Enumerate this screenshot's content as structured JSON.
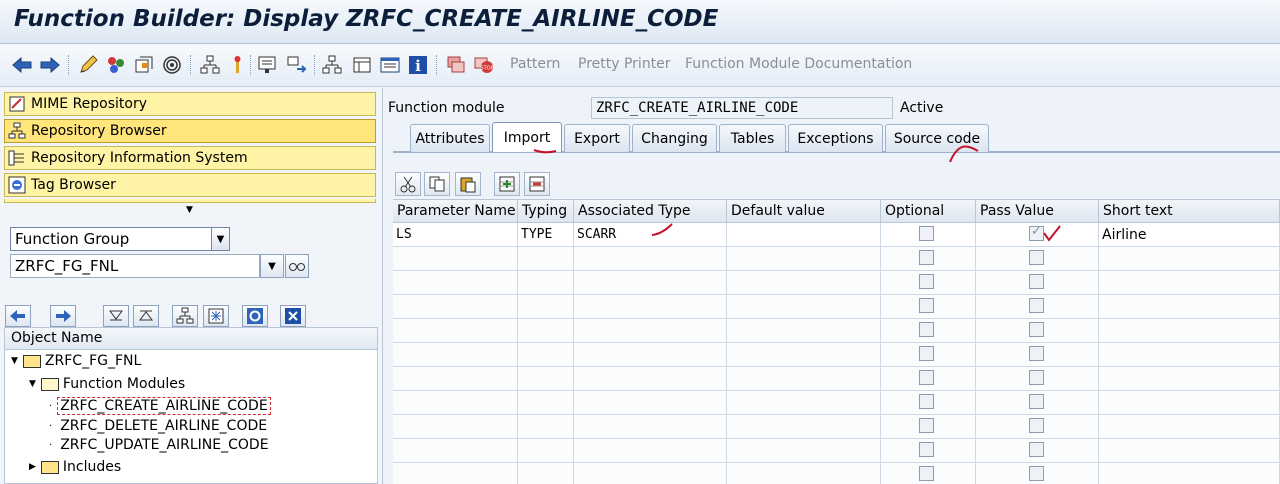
{
  "window": {
    "title": "Function Builder: Display ZRFC_CREATE_AIRLINE_CODE"
  },
  "toolbar": {
    "icons": [
      "back-icon",
      "forward-icon",
      "edit-icon",
      "other-object-icon",
      "check-icon",
      "activate-icon",
      "where-used-icon",
      "test-icon",
      "display-object-list-icon",
      "navigation-window-icon",
      "main-program-icon",
      "info-icon",
      "enhance-icon",
      "stop-icon"
    ],
    "pattern": "Pattern",
    "pretty_printer": "Pretty Printer",
    "documentation": "Function Module Documentation"
  },
  "nav": {
    "mime": "MIME Repository",
    "repo_browser": "Repository Browser",
    "repo_info": "Repository Information System",
    "tag_browser": "Tag Browser"
  },
  "object_type": {
    "selected": "Function Group"
  },
  "object_name": {
    "value": "ZRFC_FG_FNL"
  },
  "tree": {
    "header": "Object Name",
    "root": "ZRFC_FG_FNL",
    "folder": "Function Modules",
    "items": [
      "ZRFC_CREATE_AIRLINE_CODE",
      "ZRFC_DELETE_AIRLINE_CODE",
      "ZRFC_UPDATE_AIRLINE_CODE"
    ],
    "includes": "Includes"
  },
  "header": {
    "fm_label": "Function module",
    "fm_value": "ZRFC_CREATE_AIRLINE_CODE",
    "status": "Active"
  },
  "tabs": [
    "Attributes",
    "Import",
    "Export",
    "Changing",
    "Tables",
    "Exceptions",
    "Source code"
  ],
  "active_tab": "Import",
  "grid": {
    "columns": [
      "Parameter Name",
      "Typing",
      "Associated Type",
      "Default value",
      "Optional",
      "Pass Value",
      "Short text"
    ],
    "rows": [
      {
        "name": "LS",
        "typing": "TYPE",
        "type": "SCARR",
        "default": "",
        "optional": false,
        "pass_value": true,
        "short_text": "Airline"
      }
    ],
    "empty_rows": 10
  },
  "colors": {
    "nav_bg": "#fff3a6",
    "annotation": "#c8102e"
  }
}
